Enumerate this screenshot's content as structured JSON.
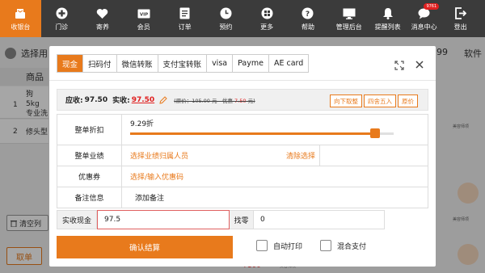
{
  "nav": {
    "items": [
      {
        "label": "收银台",
        "icon": "cashier-icon",
        "active": true
      },
      {
        "label": "门诊",
        "icon": "clinic-plus-icon"
      },
      {
        "label": "寄养",
        "icon": "heart-icon"
      },
      {
        "label": "会员",
        "icon": "vip-card-icon"
      },
      {
        "label": "订单",
        "icon": "order-doc-icon"
      },
      {
        "label": "预约",
        "icon": "clock-icon"
      },
      {
        "label": "更多",
        "icon": "grid-icon"
      },
      {
        "label": "帮助",
        "icon": "help-icon"
      },
      {
        "label": "管理后台",
        "icon": "monitor-icon"
      },
      {
        "label": "提醒列表",
        "icon": "bell-icon"
      },
      {
        "label": "消息中心",
        "icon": "chat-icon",
        "badge": "9761"
      },
      {
        "label": "登出",
        "icon": "logout-icon"
      }
    ]
  },
  "background": {
    "customer_label": "选择用",
    "table_header": "商品",
    "rows": [
      {
        "num": "1",
        "name_line1": "狗 5kg",
        "name_line2": "专业洗"
      },
      {
        "num": "2",
        "name_line1": "修头型",
        "name_line2": ""
      }
    ],
    "right_price": "99",
    "right_soft": "软件",
    "staff_label": "美容师项",
    "clear_label": "清空列",
    "hang_label": "取单",
    "bottom_price": "¥100",
    "bottom_staff": "美容师项"
  },
  "modal": {
    "tabs": [
      "现金",
      "扫码付",
      "微信转账",
      "支付宝转账",
      "visa",
      "Payme",
      "AE card"
    ],
    "active_tab": 0,
    "due_label": "应收:",
    "due_value": "97.50",
    "actual_label": "实收:",
    "actual_value": "97.50",
    "original_text": "(原价：105.00 元 - 优惠 ",
    "discount_text": "7.50",
    "original_suffix": " 元)",
    "round_buttons": [
      "向下取整",
      "四舍五入",
      "原价"
    ],
    "discount_row": {
      "label": "整单折扣",
      "value": "9.29折",
      "level": 0.929
    },
    "performance_row": {
      "label": "整单业绩",
      "placeholder": "选择业绩归属人员",
      "clear": "清除选择"
    },
    "coupon_row": {
      "label": "优惠券",
      "placeholder": "选择/输入优惠码"
    },
    "remark_row": {
      "label": "备注信息",
      "action": "添加备注"
    },
    "cash_label": "实收现金",
    "cash_value": "97.5",
    "change_label": "找零",
    "change_value": "0",
    "confirm_label": "确认结算",
    "auto_print": "自动打印",
    "mixed_pay": "混合支付"
  },
  "colors": {
    "accent": "#e87a1c",
    "nav_bg": "#3b3b3b",
    "danger": "#e02020"
  }
}
